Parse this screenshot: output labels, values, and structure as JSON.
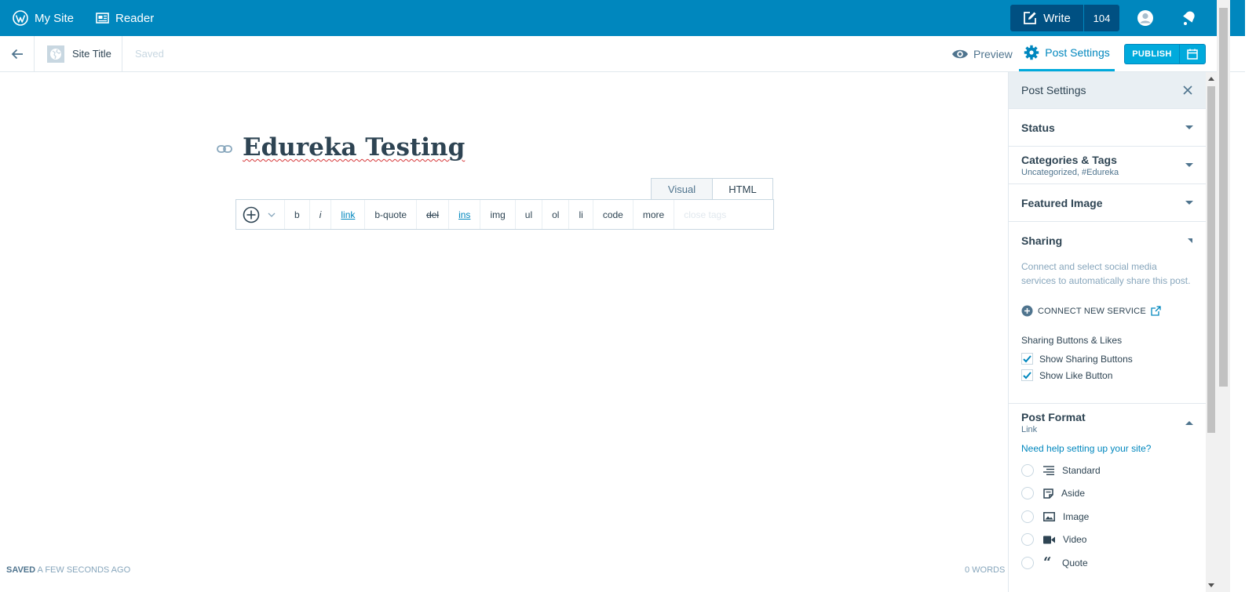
{
  "masterbar": {
    "my_site": "My Site",
    "reader": "Reader",
    "write": "Write",
    "write_count": "104"
  },
  "editor_header": {
    "site_title": "Site Title",
    "saved_status": "Saved",
    "preview": "Preview",
    "post_settings": "Post Settings",
    "publish": "PUBLISH"
  },
  "editor": {
    "title": "Edureka Testing",
    "tabs": [
      "Visual",
      "HTML"
    ],
    "toolbar": [
      "b",
      "i",
      "link",
      "b-quote",
      "del",
      "ins",
      "img",
      "ul",
      "ol",
      "li",
      "code",
      "more",
      "close tags"
    ],
    "footer_saved_label": "SAVED",
    "footer_saved_time": "A FEW SECONDS AGO",
    "word_count": "0 WORDS"
  },
  "sidebar": {
    "header": "Post Settings",
    "status": "Status",
    "categories": "Categories & Tags",
    "categories_sub": "Uncategorized, #Edureka",
    "featured_image": "Featured Image",
    "sharing": "Sharing",
    "sharing_desc": "Connect and select social media services to automatically share this post.",
    "connect_new": "CONNECT NEW SERVICE",
    "sharing_buttons_heading": "Sharing Buttons & Likes",
    "show_sharing": "Show Sharing Buttons",
    "show_like": "Show Like Button",
    "post_format": "Post Format",
    "post_format_value": "Link",
    "help_link": "Need help setting up your site?",
    "formats": [
      "Standard",
      "Aside",
      "Image",
      "Video",
      "Quote"
    ]
  },
  "colors": {
    "masterbar": "#0087be",
    "accent": "#00aadc",
    "text": "#2e4453"
  }
}
